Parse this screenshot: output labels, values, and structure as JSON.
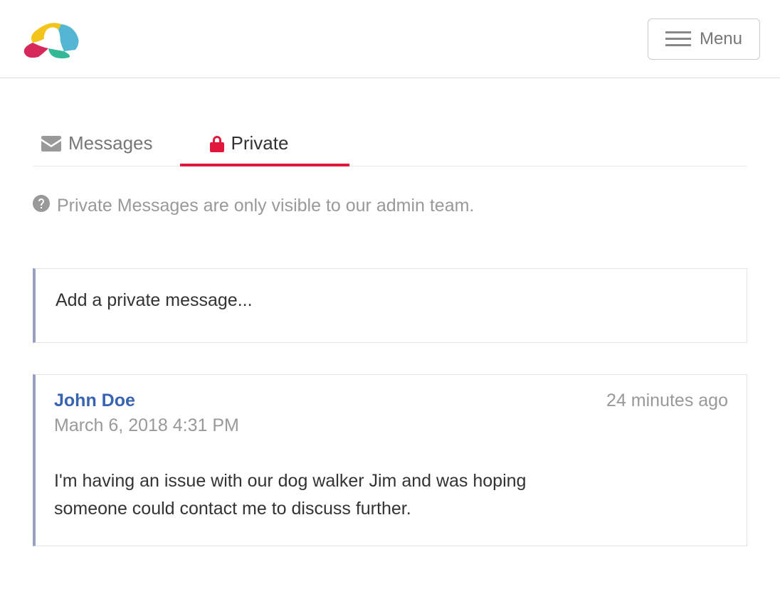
{
  "header": {
    "menu_label": "Menu"
  },
  "tabs": {
    "messages": {
      "label": "Messages"
    },
    "private": {
      "label": "Private"
    }
  },
  "info_text": "Private Messages are only visible to our admin team.",
  "compose": {
    "placeholder": "Add a private message..."
  },
  "messages": [
    {
      "author": "John Doe",
      "relative_time": "24 minutes ago",
      "timestamp": "March 6, 2018 4:31 PM",
      "body": "I'm having an issue with our dog walker Jim and was hoping someone could contact me to discuss further."
    }
  ]
}
